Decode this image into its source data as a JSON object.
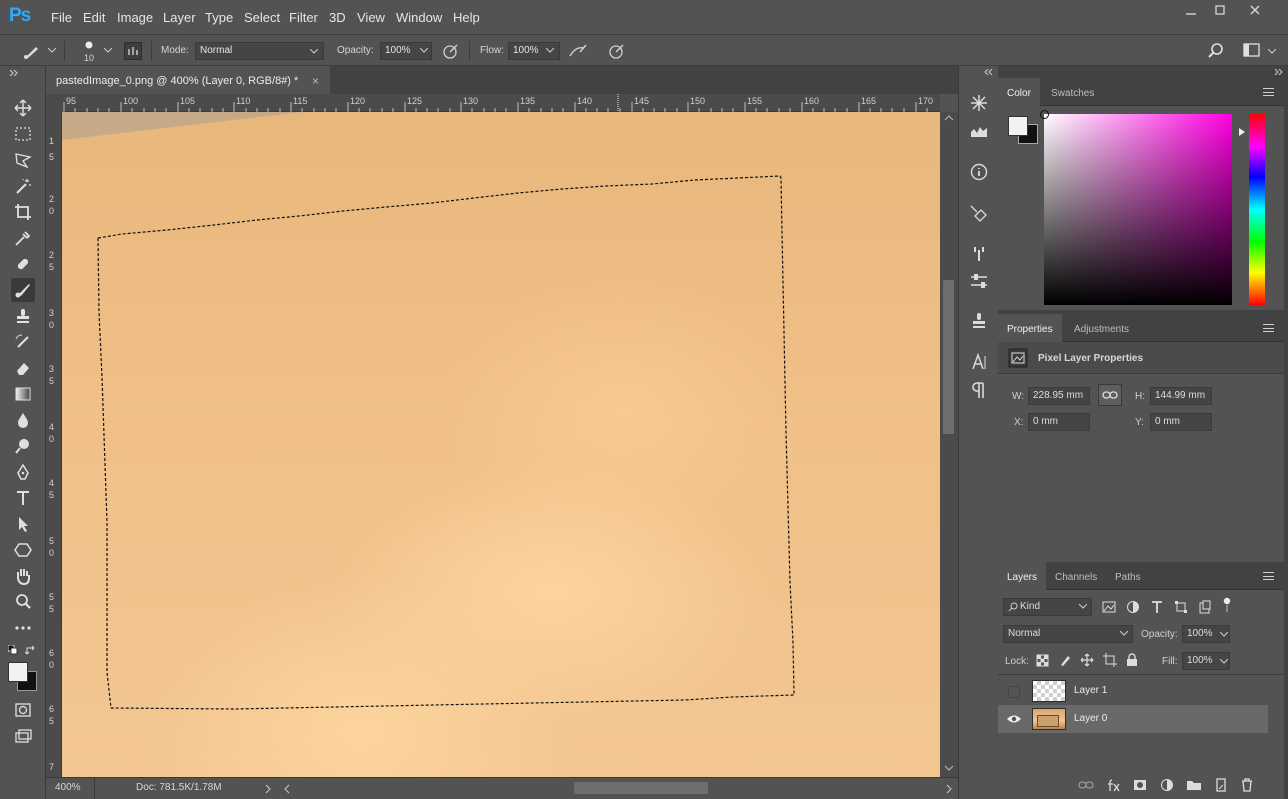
{
  "menubar": {
    "logo": "Ps",
    "items": [
      "File",
      "Edit",
      "Image",
      "Layer",
      "Type",
      "Select",
      "Filter",
      "3D",
      "View",
      "Window",
      "Help"
    ]
  },
  "options": {
    "brush_size": "10",
    "mode_label": "Mode:",
    "mode_value": "Normal",
    "opacity_label": "Opacity:",
    "opacity_value": "100%",
    "flow_label": "Flow:",
    "flow_value": "100%"
  },
  "document": {
    "tab_title": "pastedImage_0.png @ 400% (Layer 0, RGB/8#) *",
    "close_glyph": "×",
    "zoom": "400%",
    "doc_info": "Doc: 781.5K/1.78M"
  },
  "ruler": {
    "top_labels": [
      "95",
      "100",
      "105",
      "110",
      "115",
      "120",
      "125",
      "130",
      "135",
      "140",
      "145",
      "150",
      "155",
      "160",
      "165",
      "170"
    ],
    "left_labels": [
      "1",
      "5",
      "2",
      "0",
      "2",
      "5",
      "3",
      "0",
      "3",
      "5",
      "4",
      "0",
      "4",
      "5",
      "5",
      "0",
      "5",
      "5",
      "6",
      "0",
      "6",
      "5",
      "7"
    ]
  },
  "color_panel": {
    "tabs": [
      "Color",
      "Swatches"
    ],
    "fg_color": "#f2f2f2",
    "bg_color": "#111111"
  },
  "properties_panel": {
    "tabs": [
      "Properties",
      "Adjustments"
    ],
    "heading": "Pixel Layer Properties",
    "w_label": "W:",
    "w_value": "228.95 mm",
    "h_label": "H:",
    "h_value": "144.99 mm",
    "x_label": "X:",
    "x_value": "0 mm",
    "y_label": "Y:",
    "y_value": "0 mm"
  },
  "layers_panel": {
    "tabs": [
      "Layers",
      "Channels",
      "Paths"
    ],
    "kind_label": "Kind",
    "blend_mode": "Normal",
    "opacity_label": "Opacity:",
    "opacity_value": "100%",
    "lock_label": "Lock:",
    "fill_label": "Fill:",
    "fill_value": "100%",
    "layers": [
      {
        "name": "Layer 1",
        "visible": false,
        "selected": false
      },
      {
        "name": "Layer 0",
        "visible": true,
        "selected": true
      }
    ]
  },
  "colors": {
    "ps_blue": "#31a8ff",
    "ui_gray": "#535353",
    "selected_row": "#696969"
  }
}
